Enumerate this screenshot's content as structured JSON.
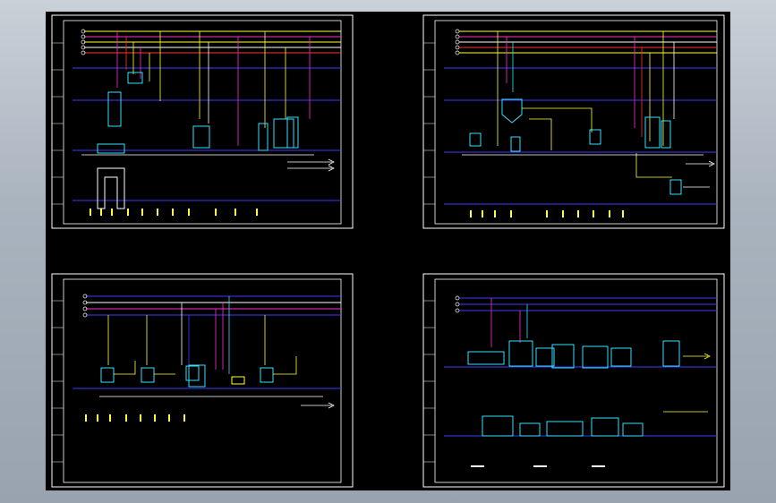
{
  "app": {
    "name": "",
    "background_color": "#000000",
    "frame_color": "#ffffff"
  },
  "colors": {
    "line_blue": "#3b3bff",
    "line_yellow": "#ffff3c",
    "line_magenta": "#ff2fd0",
    "line_red": "#ff3030",
    "line_white": "#ffffff",
    "equipment_cyan": "#36e0ff",
    "label_yellow": "#ffff00",
    "label_white": "#ffffff"
  },
  "sheets": [
    {
      "id": "sheet-top-left",
      "title": "",
      "equipment_icons": [
        "reactor-icon",
        "tank-icon",
        "tank-icon",
        "filter-icon",
        "dryer-icon",
        "pump-icon"
      ]
    },
    {
      "id": "sheet-top-right",
      "title": "",
      "equipment_icons": [
        "reactor-icon",
        "tank-icon",
        "tank-icon",
        "tank-icon",
        "dryer-icon",
        "tank-icon"
      ]
    },
    {
      "id": "sheet-bottom-left",
      "title": "",
      "equipment_icons": [
        "tank-icon",
        "tank-icon",
        "tank-icon",
        "reactor-icon",
        "pump-icon",
        "tank-icon"
      ]
    },
    {
      "id": "sheet-bottom-right",
      "title": "",
      "equipment_icons": [
        "conveyor-icon",
        "machine-icon",
        "machine-icon",
        "machine-icon",
        "conveyor-icon",
        "machine-icon"
      ]
    }
  ]
}
